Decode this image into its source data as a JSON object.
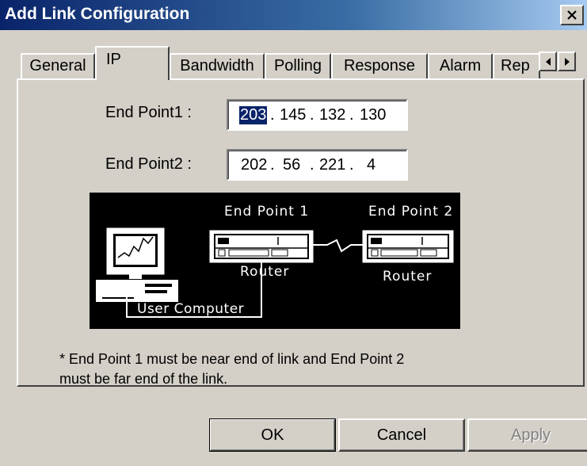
{
  "window": {
    "title": "Add Link Configuration"
  },
  "tabs": [
    {
      "label": "General"
    },
    {
      "label": "IP"
    },
    {
      "label": "Bandwidth"
    },
    {
      "label": "Polling"
    },
    {
      "label": "Response"
    },
    {
      "label": "Alarm"
    },
    {
      "label": "Rep"
    }
  ],
  "ip_tab": {
    "endpoint1": {
      "label": "End Point1 :",
      "octets": [
        "203",
        "145",
        "132",
        "130"
      ]
    },
    "endpoint2": {
      "label": "End Point2 :",
      "octets": [
        "202",
        "56",
        "221",
        "4"
      ]
    },
    "diagram": {
      "endpoint1_label": "End Point 1",
      "endpoint2_label": "End Point 2",
      "router1_label": "Router",
      "router2_label": "Router",
      "computer_label": "User Computer"
    },
    "note": {
      "line1": "* End Point 1 must be near end of link and End Point 2",
      "line2": "must be far end of the link."
    }
  },
  "buttons": {
    "ok": "OK",
    "cancel": "Cancel",
    "apply": "Apply"
  }
}
